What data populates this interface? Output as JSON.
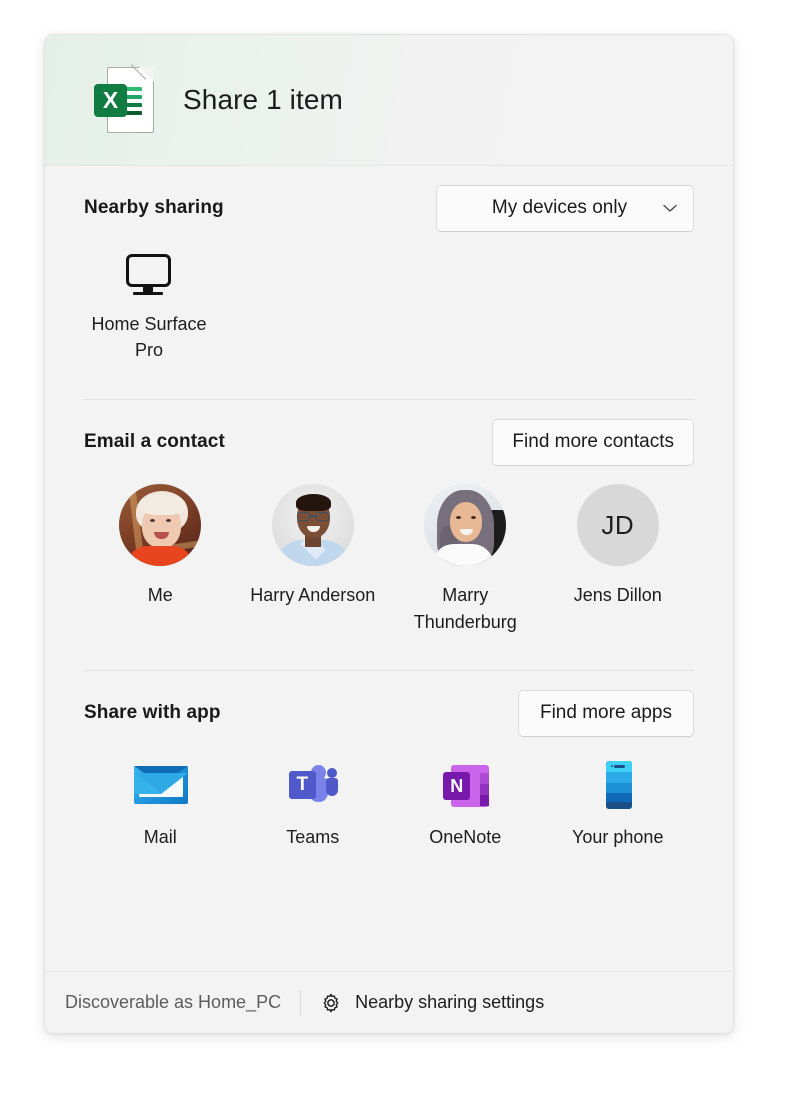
{
  "header": {
    "title": "Share 1 item",
    "file_icon": "excel-file-icon",
    "file_badge_letter": "X",
    "accent_color": "#107c41"
  },
  "nearby": {
    "section_title": "Nearby sharing",
    "dropdown_value": "My devices only",
    "dropdown_icon": "chevron-down-icon",
    "devices": [
      {
        "name": "Home Surface Pro",
        "icon": "monitor-icon"
      }
    ]
  },
  "contacts_section": {
    "section_title": "Email a contact",
    "find_more_label": "Find more contacts",
    "contacts": [
      {
        "name": "Me",
        "avatar_type": "photo",
        "initials": ""
      },
      {
        "name": "Harry Anderson",
        "avatar_type": "photo",
        "initials": ""
      },
      {
        "name": "Marry Thunderburg",
        "avatar_type": "photo",
        "initials": ""
      },
      {
        "name": "Jens Dillon",
        "avatar_type": "initials",
        "initials": "JD"
      }
    ]
  },
  "apps_section": {
    "section_title": "Share with app",
    "find_more_label": "Find more apps",
    "apps": [
      {
        "name": "Mail",
        "icon": "mail-icon"
      },
      {
        "name": "Teams",
        "icon": "teams-icon",
        "badge_letter": "T"
      },
      {
        "name": "OneNote",
        "icon": "onenote-icon",
        "badge_letter": "N"
      },
      {
        "name": "Your phone",
        "icon": "phone-icon"
      }
    ]
  },
  "footer": {
    "discoverable_text": "Discoverable as Home_PC",
    "settings_label": "Nearby sharing settings",
    "settings_icon": "gear-icon"
  }
}
